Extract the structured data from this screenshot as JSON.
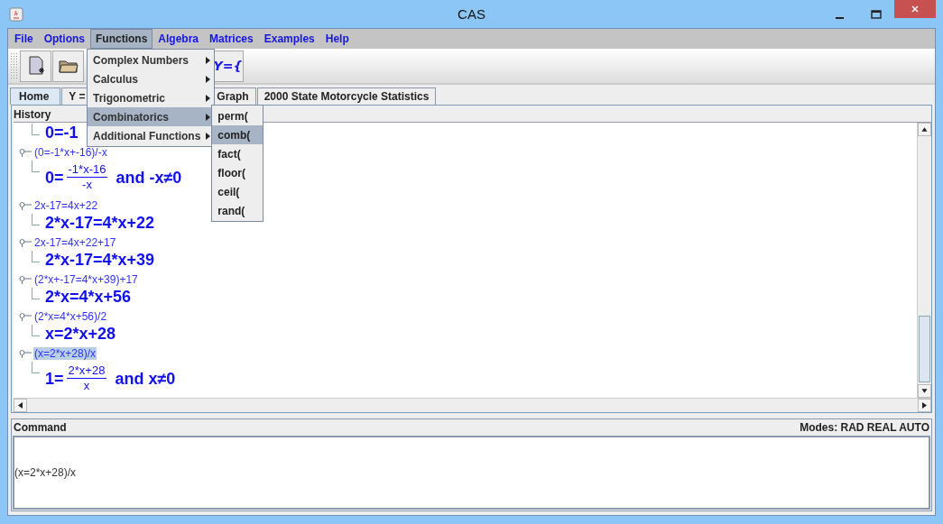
{
  "window": {
    "title": "CAS"
  },
  "menu": [
    {
      "label": "File",
      "selected": false
    },
    {
      "label": "Options",
      "selected": false
    },
    {
      "label": "Functions",
      "selected": true
    },
    {
      "label": "Algebra",
      "selected": false
    },
    {
      "label": "Matrices",
      "selected": false
    },
    {
      "label": "Examples",
      "selected": false
    },
    {
      "label": "Help",
      "selected": false
    }
  ],
  "dropdown": [
    {
      "label": "Complex Numbers",
      "selected": false
    },
    {
      "label": "Calculus",
      "selected": false
    },
    {
      "label": "Trigonometric",
      "selected": false
    },
    {
      "label": "Combinatorics",
      "selected": true
    },
    {
      "label": "Additional Functions",
      "selected": false
    }
  ],
  "submenu": [
    {
      "label": "perm(",
      "selected": false
    },
    {
      "label": "comb(",
      "selected": true
    },
    {
      "label": "fact(",
      "selected": false
    },
    {
      "label": "floor(",
      "selected": false
    },
    {
      "label": "ceil(",
      "selected": false
    },
    {
      "label": "rand(",
      "selected": false
    }
  ],
  "toolbar": {
    "formula_button": "Y={"
  },
  "tabs": [
    {
      "label": "Home",
      "selected": true
    },
    {
      "label": "Y =",
      "selected": false
    },
    {
      "label": "Graph",
      "selected": false
    },
    {
      "label": "2000 State Motorcycle Statistics",
      "selected": false
    }
  ],
  "history": {
    "title": "History",
    "entries": [
      {
        "result": {
          "kind": "plain",
          "text": "0=-1"
        },
        "selected": false
      },
      {
        "input": "(0=-1*x+-16)/-x",
        "result": {
          "kind": "fraction",
          "lhs": "0=",
          "num": "-1*x-16",
          "den": "-x",
          "tail": "and -x≠0"
        },
        "selected": false
      },
      {
        "input": "2x-17=4x+22",
        "result": {
          "kind": "plain",
          "text": "2*x-17=4*x+22"
        },
        "selected": false
      },
      {
        "input": "2x-17=4x+22+17",
        "result": {
          "kind": "plain",
          "text": "2*x-17=4*x+39"
        },
        "selected": false
      },
      {
        "input": "(2*x+-17=4*x+39)+17",
        "result": {
          "kind": "plain",
          "text": "2*x=4*x+56"
        },
        "selected": false
      },
      {
        "input": "(2*x=4*x+56)/2",
        "result": {
          "kind": "plain",
          "text": "x=2*x+28"
        },
        "selected": false
      },
      {
        "input": "(x=2*x+28)/x",
        "result": {
          "kind": "fraction",
          "lhs": "1=",
          "num": "2*x+28",
          "den": "x",
          "tail": "and x≠0"
        },
        "selected": true
      }
    ]
  },
  "command": {
    "title": "Command",
    "modes": "Modes: RAD REAL AUTO",
    "value": "(x=2*x+28)/x"
  }
}
